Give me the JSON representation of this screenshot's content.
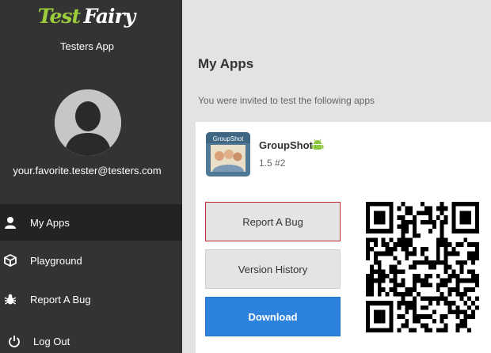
{
  "logo": {
    "part1": "Test",
    "part2": "Fairy"
  },
  "sidebar": {
    "app_subtitle": "Testers App",
    "user_email": "your.favorite.tester@testers.com",
    "items": [
      {
        "label": "My Apps",
        "icon": "user-icon",
        "active": true
      },
      {
        "label": "Playground",
        "icon": "cube-icon",
        "active": false
      },
      {
        "label": "Report A Bug",
        "icon": "bug-icon",
        "active": false
      },
      {
        "label": "Log Out",
        "icon": "power-icon",
        "active": false
      }
    ]
  },
  "main": {
    "title": "My Apps",
    "subtitle": "You were invited to test the following apps",
    "app": {
      "name": "GroupShot",
      "thumb_label": "GroupShot",
      "platform_icon": "android-icon",
      "version": "1.5 #2",
      "buttons": {
        "report_bug": "Report A Bug",
        "version_history": "Version History",
        "download": "Download"
      }
    }
  },
  "colors": {
    "sidebar_bg": "#333333",
    "sidebar_active": "#232323",
    "logo_green": "#9ccc3c",
    "download_blue": "#2c82dc",
    "report_border": "#c0282f",
    "android_green": "#8cc63f"
  }
}
